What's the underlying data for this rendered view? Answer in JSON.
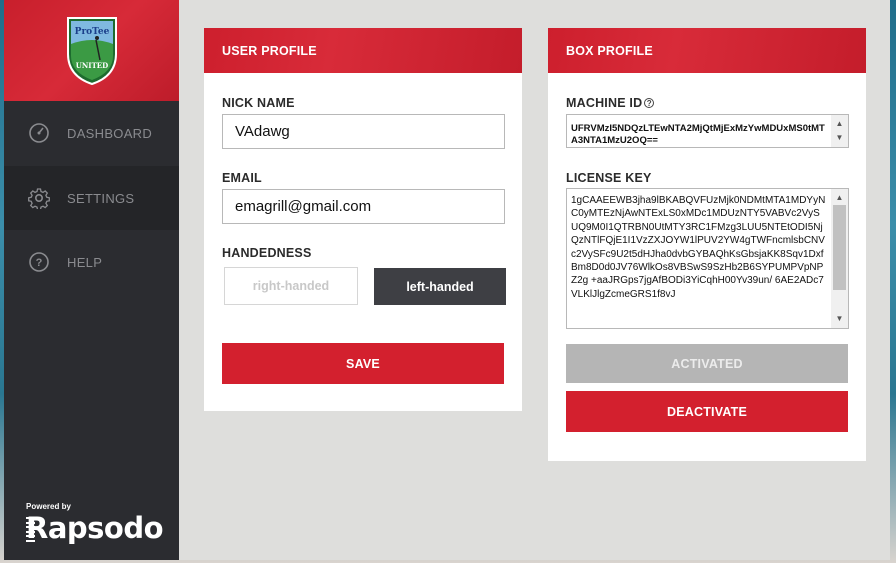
{
  "sidebar": {
    "items": [
      {
        "label": "DASHBOARD",
        "icon": "gauge-icon"
      },
      {
        "label": "SETTINGS",
        "icon": "gear-icon"
      },
      {
        "label": "HELP",
        "icon": "help-icon"
      }
    ],
    "logo_text_top": "ProTee",
    "logo_text_bottom": "UNITED",
    "powered_by": "Powered by",
    "brand": "Rapsodo"
  },
  "user_profile": {
    "title": "USER PROFILE",
    "nick_name_label": "NICK NAME",
    "nick_name_value": "VAdawg",
    "email_label": "EMAIL",
    "email_value": "emagrill@gmail.com",
    "handedness_label": "HANDEDNESS",
    "right_handed_label": "right-handed",
    "left_handed_label": "left-handed",
    "selected_handedness": "left-handed",
    "save_label": "SAVE"
  },
  "box_profile": {
    "title": "BOX PROFILE",
    "machine_id_label": "MACHINE ID",
    "machine_id_value": "UFRVMzI5NDQzLTEwNTA2MjQtMjExMzYwMDUxMS0tMTA3NTA1MzU2OQ==",
    "license_key_label": "LICENSE KEY",
    "license_key_value": "1gCAAEEWB3jha9lBKABQVFUzMjk0NDMtMTA1MDYyNC0yMTEzNjAwNTExLS0xMDc1MDUzNTY5VABVc2VySUQ9M0I1QTRBN0UtMTY3RC1FMzg3LUU5NTEtODI5NjQzNTlFQjE1I1VzZXJOYW1lPUV2YW4gTWFncmlsbCNVc2VySFc9U2t5dHJha0dvbGYBAQhKsGbsjaKK8Sqv1DxfBm8D0d0JV76WlkOs8VBSwS9SzHb2B6SYPUMPVpNPZ2g\n+aaJRGps7jgAfBODi3YiCqhH00Yv39un/\n6AE2ADc7VLKlJlgZcmeGRS1f8vJ\n",
    "activated_label": "ACTIVATED",
    "deactivate_label": "DEACTIVATE"
  },
  "colors": {
    "brand_red": "#d3202e",
    "sidebar_dark": "#2b2c30",
    "selected_toggle": "#3e3f44",
    "disabled_grey": "#b5b5b5"
  }
}
